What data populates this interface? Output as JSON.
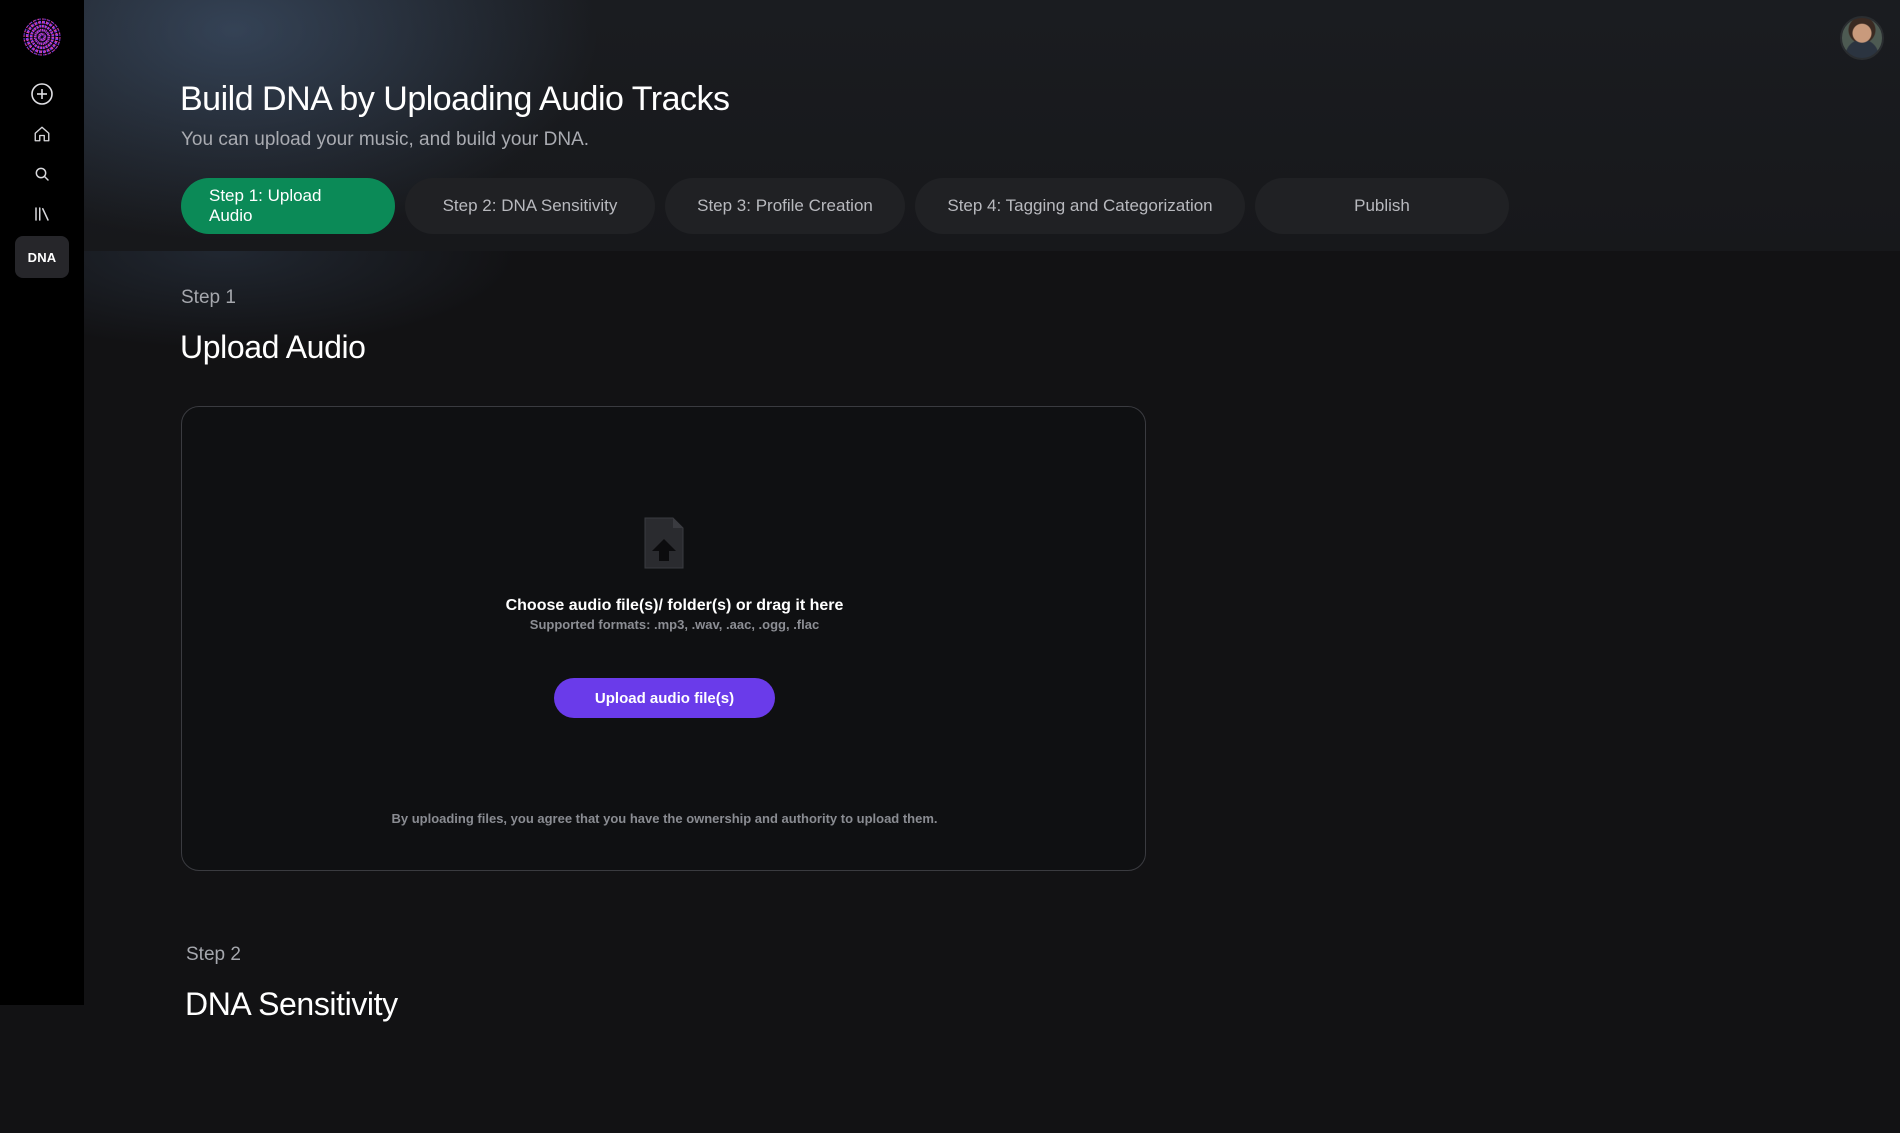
{
  "sidebar": {
    "logo": "brand-logo",
    "items": [
      {
        "icon": "plus-circle-icon"
      },
      {
        "icon": "home-icon"
      },
      {
        "icon": "search-icon"
      },
      {
        "icon": "library-icon"
      },
      {
        "label": "DNA"
      }
    ]
  },
  "header": {
    "title": "Build DNA by Uploading Audio Tracks",
    "subtitle": "You can upload your music, and build your DNA.",
    "avatar": "user-avatar"
  },
  "steps": [
    {
      "label": "Step 1: Upload Audio",
      "active": true
    },
    {
      "label": "Step 2: DNA Sensitivity",
      "active": false
    },
    {
      "label": "Step 3: Profile Creation",
      "active": false
    },
    {
      "label": "Step 4: Tagging and Categorization",
      "active": false
    },
    {
      "label": "Publish",
      "active": false
    }
  ],
  "section1": {
    "step_label": "Step 1",
    "title": "Upload Audio",
    "upload": {
      "heading": "Choose audio file(s)/ folder(s) or drag it here",
      "formats": "Supported formats: .mp3, .wav, .aac, .ogg, .flac",
      "button_label": "Upload audio file(s)",
      "disclaimer": "By uploading files, you agree that you have the ownership and authority to upload them."
    }
  },
  "section2": {
    "step_label": "Step 2",
    "title": "DNA Sensitivity"
  },
  "colors": {
    "active_step": "#0b8a57",
    "upload_button": "#6a3bea",
    "background": "#121214",
    "sidebar": "#000000"
  }
}
